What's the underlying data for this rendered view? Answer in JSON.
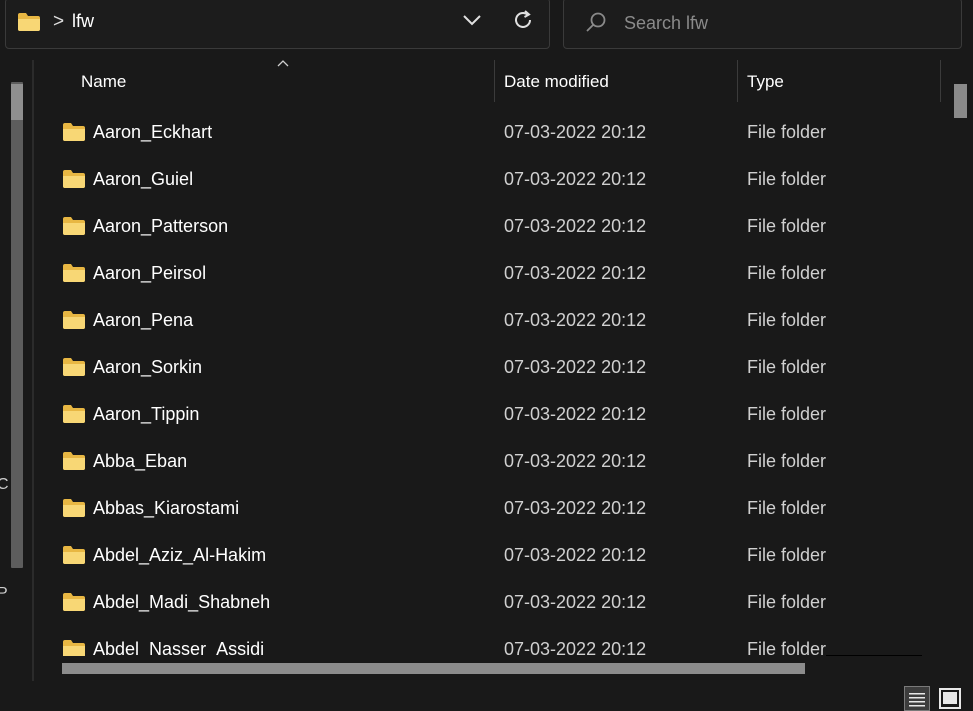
{
  "address_bar": {
    "path_separator": ">",
    "current_folder": "lfw"
  },
  "search": {
    "placeholder": "Search lfw"
  },
  "columns": {
    "name": "Name",
    "date_modified": "Date modified",
    "type": "Type",
    "sort_indicator": "^"
  },
  "nav_fragments": [
    "C",
    "P"
  ],
  "rows": [
    {
      "name": "Aaron_Eckhart",
      "date": "07-03-2022 20:12",
      "type": "File folder"
    },
    {
      "name": "Aaron_Guiel",
      "date": "07-03-2022 20:12",
      "type": "File folder"
    },
    {
      "name": "Aaron_Patterson",
      "date": "07-03-2022 20:12",
      "type": "File folder"
    },
    {
      "name": "Aaron_Peirsol",
      "date": "07-03-2022 20:12",
      "type": "File folder"
    },
    {
      "name": "Aaron_Pena",
      "date": "07-03-2022 20:12",
      "type": "File folder"
    },
    {
      "name": "Aaron_Sorkin",
      "date": "07-03-2022 20:12",
      "type": "File folder"
    },
    {
      "name": "Aaron_Tippin",
      "date": "07-03-2022 20:12",
      "type": "File folder"
    },
    {
      "name": "Abba_Eban",
      "date": "07-03-2022 20:12",
      "type": "File folder"
    },
    {
      "name": "Abbas_Kiarostami",
      "date": "07-03-2022 20:12",
      "type": "File folder"
    },
    {
      "name": "Abdel_Aziz_Al-Hakim",
      "date": "07-03-2022 20:12",
      "type": "File folder"
    },
    {
      "name": "Abdel_Madi_Shabneh",
      "date": "07-03-2022 20:12",
      "type": "File folder"
    },
    {
      "name": "Abdel_Nasser_Assidi",
      "date": "07-03-2022 20:12",
      "type": "File folder"
    }
  ],
  "icons": {
    "folder": "folder-icon",
    "chevron": "chevron-down-icon",
    "refresh": "refresh-icon",
    "search": "search-icon",
    "details_view": "details-view-icon",
    "tiles_view": "large-icons-view-icon"
  },
  "colors": {
    "background": "#191919",
    "folder_yellow": "#f8d775",
    "text": "#ffffff",
    "secondary_text": "#d0d0d0"
  }
}
